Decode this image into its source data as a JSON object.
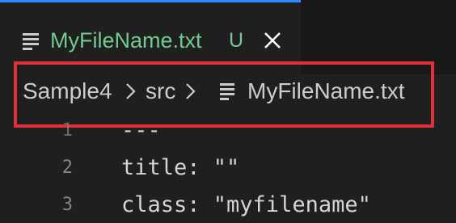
{
  "tab": {
    "title": "MyFileName.txt",
    "status": "U",
    "file_icon": "lines-file-icon",
    "close_icon": "close-icon",
    "title_color": "#73c991",
    "active_border_color": "#2e8cff"
  },
  "breadcrumb": {
    "items": [
      "Sample4",
      "src",
      "MyFileName.txt"
    ],
    "separator_icon": "chevron-right-icon",
    "file_icon": "lines-file-icon"
  },
  "editor": {
    "lines": [
      {
        "number": "1",
        "text": "---"
      },
      {
        "number": "2",
        "text": "title: \"\""
      },
      {
        "number": "3",
        "text": "class: \"myfilename\""
      }
    ]
  },
  "annotation": {
    "highlight_color": "#e0313a"
  }
}
